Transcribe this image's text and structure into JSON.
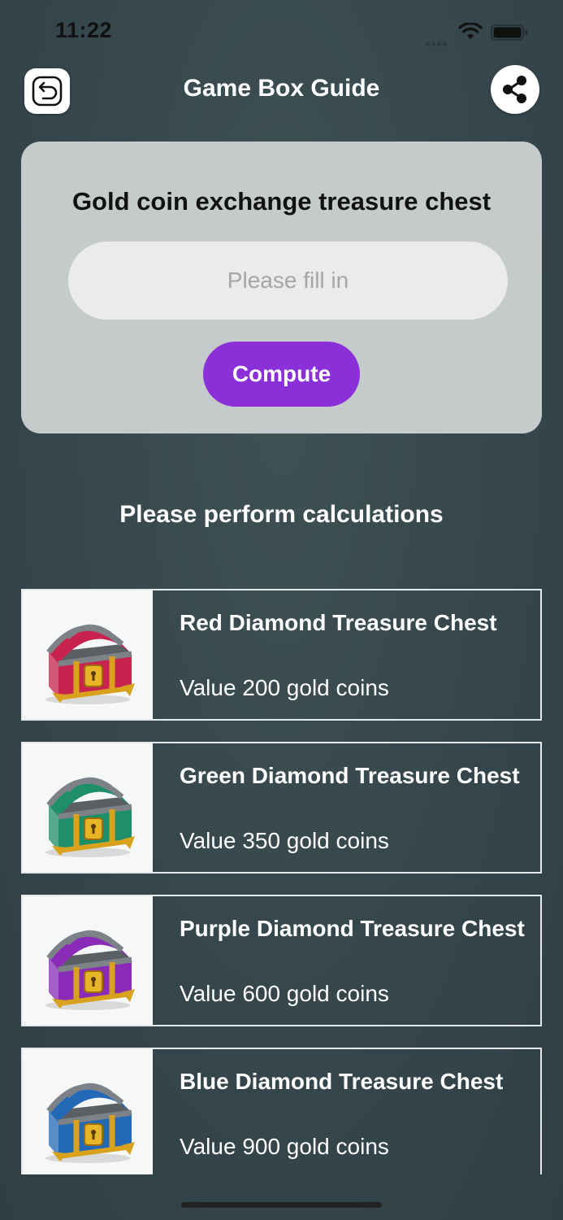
{
  "status_bar": {
    "time": "11:22",
    "icons": [
      "signal-icon",
      "wifi-icon",
      "battery-icon"
    ]
  },
  "header": {
    "title": "Game Box Guide",
    "back_icon": "back-arrow-icon",
    "share_icon": "share-icon"
  },
  "calculator": {
    "heading": "Gold coin exchange treasure chest",
    "input_value": "",
    "input_placeholder": "Please fill in",
    "compute_label": "Compute",
    "accent_color": "#8b2fd9"
  },
  "result": {
    "message": "Please perform calculations"
  },
  "chests": [
    {
      "name": "Red Diamond Treasure Chest",
      "value": "Value 200 gold coins",
      "gem_color": "#c8234f",
      "icon": "red-treasure-chest-icon"
    },
    {
      "name": "Green Diamond Treasure Chest",
      "value": "Value 350 gold coins",
      "gem_color": "#1f8f6a",
      "icon": "green-treasure-chest-icon"
    },
    {
      "name": "Purple Diamond Treasure Chest",
      "value": "Value 600 gold coins",
      "gem_color": "#8a2bb8",
      "icon": "purple-treasure-chest-icon"
    },
    {
      "name": "Blue Diamond Treasure Chest",
      "value": "Value 900 gold coins",
      "gem_color": "#2469b8",
      "icon": "blue-treasure-chest-icon"
    }
  ]
}
